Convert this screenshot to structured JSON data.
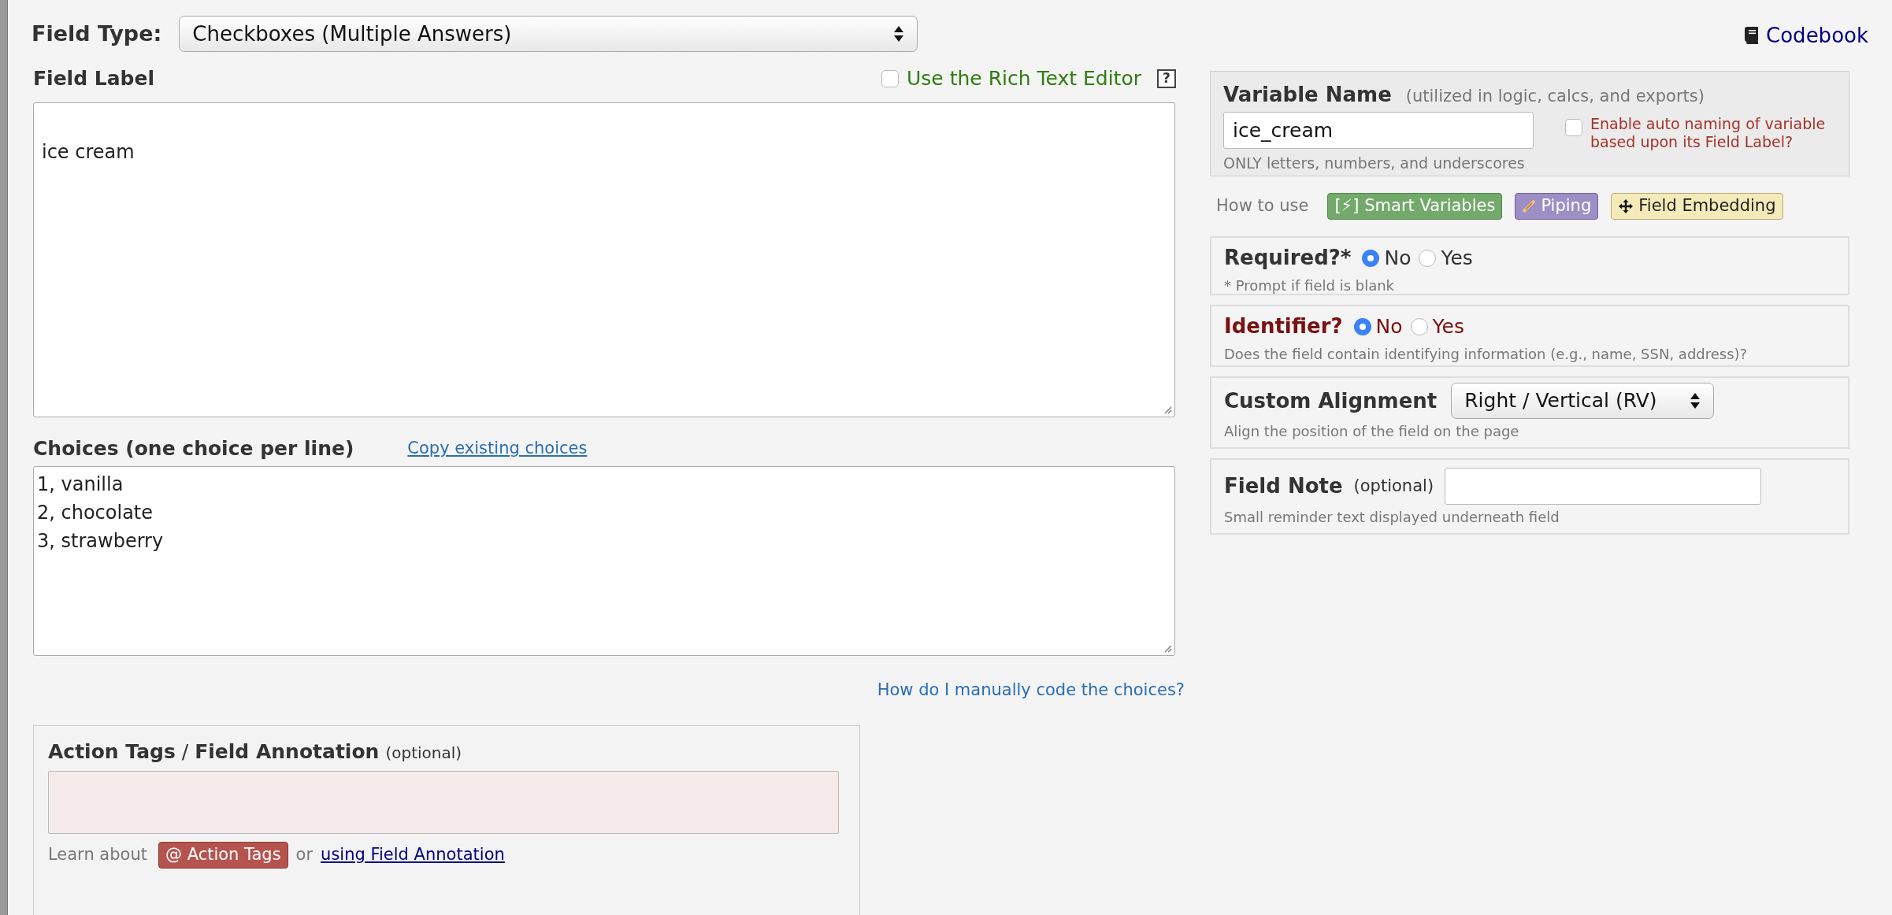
{
  "field_type": {
    "label": "Field Type:",
    "value": "Checkboxes (Multiple Answers)"
  },
  "codebook_link": "Codebook",
  "field_label": {
    "heading": "Field Label",
    "rich_text_editor": {
      "label": "Use the Rich Text Editor",
      "checked": false
    },
    "help": "?",
    "value": "ice cream"
  },
  "choices": {
    "heading": "Choices (one choice per line)",
    "copy_link": "Copy existing choices",
    "lines": [
      "1, vanilla",
      "2, chocolate",
      "3, strawberry"
    ],
    "help_link": "How do I manually code the choices?"
  },
  "action_tags": {
    "heading": "**Action Tags** / **Field Annotation**",
    "optional": "(optional)",
    "learn_prefix": "Learn about",
    "button": "@ Action Tags",
    "or": "or",
    "annotation_link": "using Field Annotation"
  },
  "variable_name": {
    "heading": "Variable Name",
    "note": "(utilized in logic, calcs, and exports)",
    "value": "ice_cream",
    "hint": "ONLY letters, numbers, and underscores",
    "auto_naming": {
      "label": "Enable auto naming of variable based upon its Field Label?",
      "checked": false
    }
  },
  "how_to_use": {
    "label": "How to use",
    "buttons": [
      {
        "kind": "smart",
        "label": "[⚡] Smart Variables"
      },
      {
        "kind": "piping",
        "label": "Piping"
      },
      {
        "kind": "embedding",
        "label": "Field Embedding"
      }
    ]
  },
  "required": {
    "label": "Required?*",
    "options": [
      {
        "label": "No",
        "selected": true
      },
      {
        "label": "Yes",
        "selected": false
      }
    ],
    "hint": "* Prompt if field is blank"
  },
  "identifier": {
    "label": "Identifier?",
    "options": [
      {
        "label": "No",
        "selected": true
      },
      {
        "label": "Yes",
        "selected": false
      }
    ],
    "hint": "Does the field contain identifying information (e.g., name, SSN, address)?"
  },
  "custom_alignment": {
    "label": "Custom Alignment",
    "value": "Right / Vertical (RV)",
    "hint": "Align the position of the field on the page"
  },
  "field_note": {
    "label": "Field Note",
    "optional": "(optional)",
    "hint": "Small reminder text displayed underneath field"
  }
}
